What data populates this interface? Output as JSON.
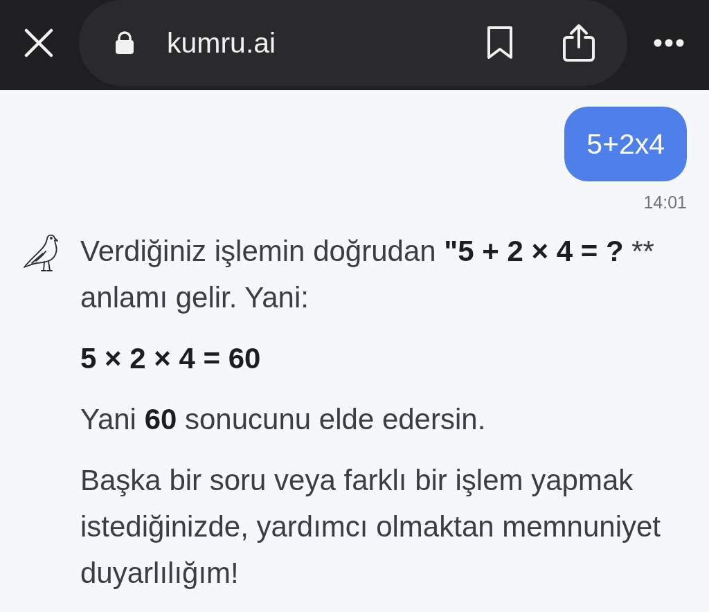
{
  "browser_bar": {
    "url": "kumru.ai"
  },
  "messages": [
    {
      "kind": "user",
      "text": "5+2x4",
      "time": "14:01"
    },
    {
      "kind": "assistant",
      "paragraphs": [
        {
          "kind": "text",
          "text": "Verdiğiniz işlemin doğrudan **\"5 + 2 × 4 = ?** ** anlamı gelir. Yani:"
        },
        {
          "kind": "formula",
          "text": "5 × 2 × 4 = 60"
        },
        {
          "kind": "text",
          "text": "Yani **60** sonucunu elde edersin."
        },
        {
          "kind": "text",
          "text": "Başka bir soru veya farklı bir işlem yapmak istediğinizde, yardımcı olmaktan memnuniyet duyarlılığım!"
        }
      ]
    }
  ]
}
